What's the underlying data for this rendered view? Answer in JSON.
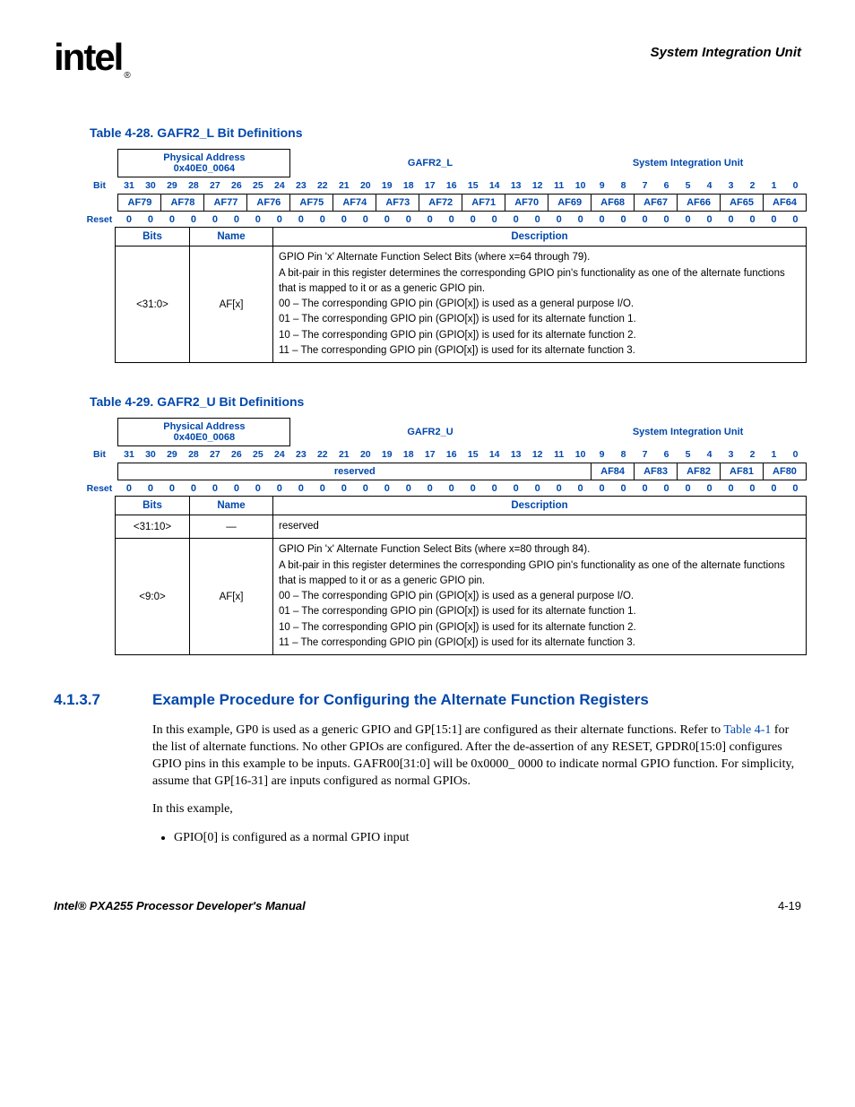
{
  "header": {
    "logo_text": "intel",
    "reg_mark": "®",
    "section_title": "System Integration Unit"
  },
  "table28": {
    "title": "Table 4-28. GAFR2_L Bit Definitions",
    "phys_addr_label": "Physical Address",
    "phys_addr": "0x40E0_0064",
    "reg_name": "GAFR2_L",
    "module": "System Integration Unit",
    "bit_label": "Bit",
    "reset_label": "Reset",
    "bits": [
      "31",
      "30",
      "29",
      "28",
      "27",
      "26",
      "25",
      "24",
      "23",
      "22",
      "21",
      "20",
      "19",
      "18",
      "17",
      "16",
      "15",
      "14",
      "13",
      "12",
      "11",
      "10",
      "9",
      "8",
      "7",
      "6",
      "5",
      "4",
      "3",
      "2",
      "1",
      "0"
    ],
    "fields": [
      "AF79",
      "AF78",
      "AF77",
      "AF76",
      "AF75",
      "AF74",
      "AF73",
      "AF72",
      "AF71",
      "AF70",
      "AF69",
      "AF68",
      "AF67",
      "AF66",
      "AF65",
      "AF64"
    ],
    "reset_vals": [
      "0",
      "0",
      "0",
      "0",
      "0",
      "0",
      "0",
      "0",
      "0",
      "0",
      "0",
      "0",
      "0",
      "0",
      "0",
      "0",
      "0",
      "0",
      "0",
      "0",
      "0",
      "0",
      "0",
      "0",
      "0",
      "0",
      "0",
      "0",
      "0",
      "0",
      "0",
      "0"
    ],
    "desc_headers": {
      "bits": "Bits",
      "name": "Name",
      "description": "Description"
    },
    "row": {
      "bits": "<31:0>",
      "name": "AF[x]",
      "lines": [
        "GPIO Pin 'x' Alternate Function Select Bits (where x=64 through 79).",
        "A bit-pair in this register determines the corresponding GPIO pin's functionality as one of the alternate functions that is mapped to it or as a generic GPIO pin.",
        "00 – The corresponding GPIO pin (GPIO[x]) is used as a general purpose I/O.",
        "01 – The corresponding GPIO pin (GPIO[x]) is used for its alternate function 1.",
        "10 – The corresponding GPIO pin (GPIO[x]) is used for its alternate function 2.",
        "11 – The corresponding GPIO pin (GPIO[x]) is used for its alternate function 3."
      ]
    }
  },
  "table29": {
    "title": "Table 4-29. GAFR2_U Bit Definitions",
    "phys_addr_label": "Physical Address",
    "phys_addr": "0x40E0_0068",
    "reg_name": "GAFR2_U",
    "module": "System Integration Unit",
    "bit_label": "Bit",
    "reset_label": "Reset",
    "bits": [
      "31",
      "30",
      "29",
      "28",
      "27",
      "26",
      "25",
      "24",
      "23",
      "22",
      "21",
      "20",
      "19",
      "18",
      "17",
      "16",
      "15",
      "14",
      "13",
      "12",
      "11",
      "10",
      "9",
      "8",
      "7",
      "6",
      "5",
      "4",
      "3",
      "2",
      "1",
      "0"
    ],
    "reserved_label": "reserved",
    "fields": [
      "AF84",
      "AF83",
      "AF82",
      "AF81",
      "AF80"
    ],
    "reset_vals": [
      "0",
      "0",
      "0",
      "0",
      "0",
      "0",
      "0",
      "0",
      "0",
      "0",
      "0",
      "0",
      "0",
      "0",
      "0",
      "0",
      "0",
      "0",
      "0",
      "0",
      "0",
      "0",
      "0",
      "0",
      "0",
      "0",
      "0",
      "0",
      "0",
      "0",
      "0",
      "0"
    ],
    "desc_headers": {
      "bits": "Bits",
      "name": "Name",
      "description": "Description"
    },
    "row0": {
      "bits": "<31:10>",
      "name": "—",
      "desc": "reserved"
    },
    "row1": {
      "bits": "<9:0>",
      "name": "AF[x]",
      "lines": [
        "GPIO Pin 'x' Alternate Function Select Bits (where x=80 through 84).",
        "A bit-pair in this register determines the corresponding GPIO pin's functionality as one of the alternate functions that is mapped to it or as a generic GPIO pin.",
        "00 – The corresponding GPIO pin (GPIO[x]) is used as a general purpose I/O.",
        "01 – The corresponding GPIO pin (GPIO[x]) is used for its alternate function 1.",
        "10 – The corresponding GPIO pin (GPIO[x]) is used for its alternate function 2.",
        "11 – The corresponding GPIO pin (GPIO[x]) is used for its alternate function 3."
      ]
    }
  },
  "section": {
    "number": "4.1.3.7",
    "title": "Example Procedure for Configuring the Alternate Function Registers",
    "para1_a": "In this example, GP0 is used as a generic GPIO and GP[15:1] are configured as their alternate functions. Refer to ",
    "para1_link": "Table 4-1",
    "para1_b": " for the list of alternate functions. No other GPIOs are configured. After the de-assertion of any RESET, GPDR0[15:0] configures GPIO pins in this example to be inputs. GAFR00[31:0] will be 0x0000_ 0000 to indicate normal GPIO function. For simplicity, assume that GP[16-31] are inputs configured as normal GPIOs.",
    "para2": "In this example,",
    "bullet1": "GPIO[0] is configured as a normal GPIO input"
  },
  "footer": {
    "manual": "Intel® PXA255 Processor Developer's Manual",
    "page": "4-19"
  }
}
